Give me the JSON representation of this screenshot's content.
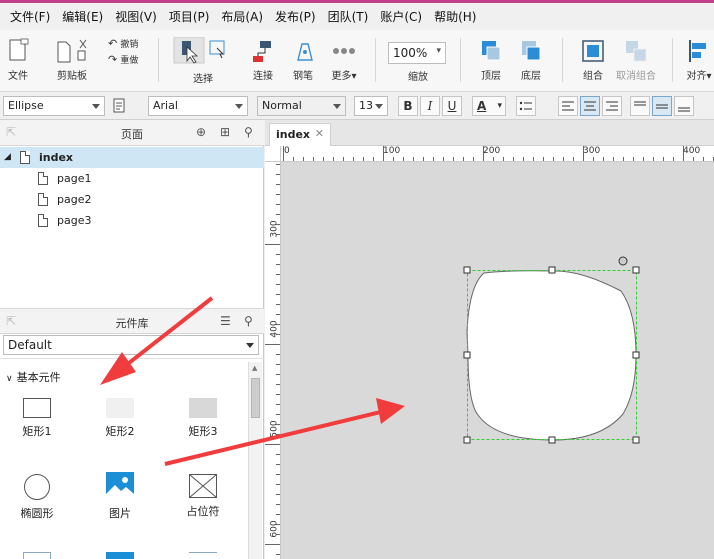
{
  "menu": [
    "文件(F)",
    "编辑(E)",
    "视图(V)",
    "项目(P)",
    "布局(A)",
    "发布(P)",
    "团队(T)",
    "账户(C)",
    "帮助(H)"
  ],
  "toolbar": {
    "file_label": "文件",
    "clipboard_label": "剪贴板",
    "undo_label": "撤销",
    "redo_label": "重做",
    "select_label": "选择",
    "connect_label": "连接",
    "pen_label": "钢笔",
    "more_label": "更多▾",
    "zoom_value": "100%",
    "zoom_label": "缩放",
    "top_label": "顶层",
    "bottom_label": "底层",
    "group_label": "组合",
    "ungroup_label": "取消组合",
    "align_label": "对齐▾"
  },
  "format": {
    "shape_type": "Ellipse",
    "font_family": "Arial",
    "font_style": "Normal",
    "font_size": "13",
    "bold": "B",
    "italic": "I",
    "underline": "U",
    "text_color": "A"
  },
  "pages_panel": {
    "title": "页面",
    "items": [
      {
        "label": "index"
      },
      {
        "label": "page1"
      },
      {
        "label": "page2"
      },
      {
        "label": "page3"
      }
    ]
  },
  "library_panel": {
    "title": "元件库",
    "library_selected": "Default",
    "section": "基本元件",
    "components": [
      {
        "label": "矩形1",
        "icon": "rectangle-outline-icon"
      },
      {
        "label": "矩形2",
        "icon": "rectangle-light-icon"
      },
      {
        "label": "矩形3",
        "icon": "rectangle-gray-icon"
      },
      {
        "label": "椭圆形",
        "icon": "ellipse-icon"
      },
      {
        "label": "图片",
        "icon": "image-icon"
      },
      {
        "label": "占位符",
        "icon": "placeholder-icon"
      }
    ]
  },
  "canvas": {
    "tab_label": "index",
    "ruler_top": [
      "0",
      "100",
      "200",
      "300",
      "400"
    ],
    "ruler_left": [
      "300",
      "400",
      "500",
      "600"
    ]
  },
  "colors": {
    "accent_magenta": "#c0408a",
    "selection_green": "#33cc33",
    "arrow_red": "#f03c3c",
    "brand_blue": "#1a8fd6",
    "selected_row": "#cfe6f5"
  }
}
